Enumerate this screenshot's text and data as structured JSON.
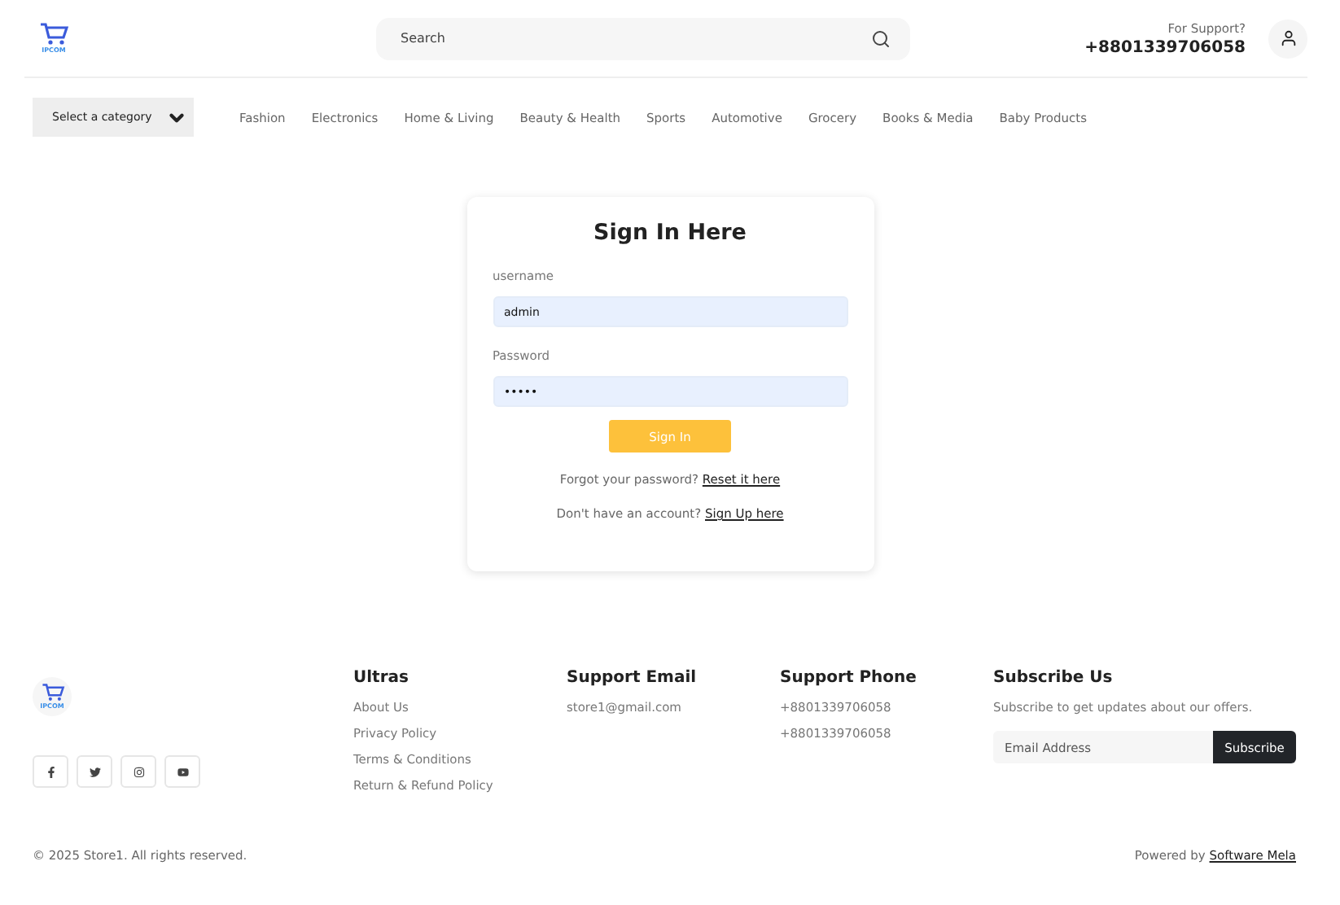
{
  "header": {
    "logo_text": "IPCOM",
    "search": {
      "placeholder": "Search"
    },
    "support_label": "For Support?",
    "support_phone": "+8801339706058"
  },
  "category_select": "Select a category",
  "nav": [
    "Fashion",
    "Electronics",
    "Home & Living",
    "Beauty & Health",
    "Sports",
    "Automotive",
    "Grocery",
    "Books & Media",
    "Baby Products"
  ],
  "signin": {
    "title": "Sign In Here",
    "fields": [
      {
        "label": "username",
        "value": "admin"
      },
      {
        "label": "Password",
        "value": "•••••"
      }
    ],
    "button": "Sign In",
    "forgot_text": "Forgot your password?",
    "forgot_link": "Reset it here",
    "signup_text": "Don't have an account?",
    "signup_link": "Sign Up here"
  },
  "footer": {
    "logo_text": "IPCOM",
    "social": [
      {
        "kind": "facebook"
      },
      {
        "kind": "twitter"
      },
      {
        "kind": "instagram"
      },
      {
        "kind": "youtube"
      }
    ],
    "columns": [
      {
        "title": "Ultras",
        "items": [
          "About Us",
          "Privacy Policy",
          "Terms & Conditions",
          "Return & Refund Policy"
        ]
      },
      {
        "title": "Support Email",
        "items": [
          "store1@gmail.com"
        ]
      },
      {
        "title": "Support Phone",
        "items": [
          "+8801339706058",
          "+8801339706058"
        ]
      }
    ],
    "subscribe": {
      "title": "Subscribe Us",
      "text": "Subscribe to get updates about our offers.",
      "placeholder": "Email Address",
      "button": "Subscribe"
    },
    "copyright": "© 2025 Store1. All rights reserved.",
    "powered_text": "Powered by",
    "powered_link": "Software Mela"
  }
}
